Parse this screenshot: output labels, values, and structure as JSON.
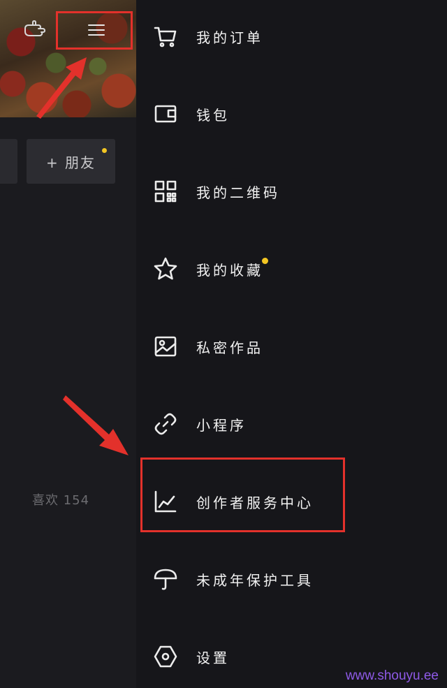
{
  "profile": {
    "add_friend_label": "+ 朋友",
    "likes_label": "喜欢 154"
  },
  "drawer": {
    "items": [
      {
        "label": "我的订单",
        "icon": "shopping-cart-icon"
      },
      {
        "label": "钱包",
        "icon": "wallet-icon"
      },
      {
        "label": "我的二维码",
        "icon": "qr-code-icon"
      },
      {
        "label": "我的收藏",
        "icon": "star-icon",
        "badge": true
      },
      {
        "label": "私密作品",
        "icon": "image-icon"
      },
      {
        "label": "小程序",
        "icon": "link-icon"
      },
      {
        "label": "创作者服务中心",
        "icon": "chart-line-icon"
      },
      {
        "label": "未成年保护工具",
        "icon": "umbrella-icon"
      },
      {
        "label": "设置",
        "icon": "hexagon-settings-icon"
      }
    ]
  },
  "annotations": {
    "highlight_color": "#e3312b",
    "badge_color": "#f3c623"
  },
  "watermark": "www.shouyu.ee"
}
